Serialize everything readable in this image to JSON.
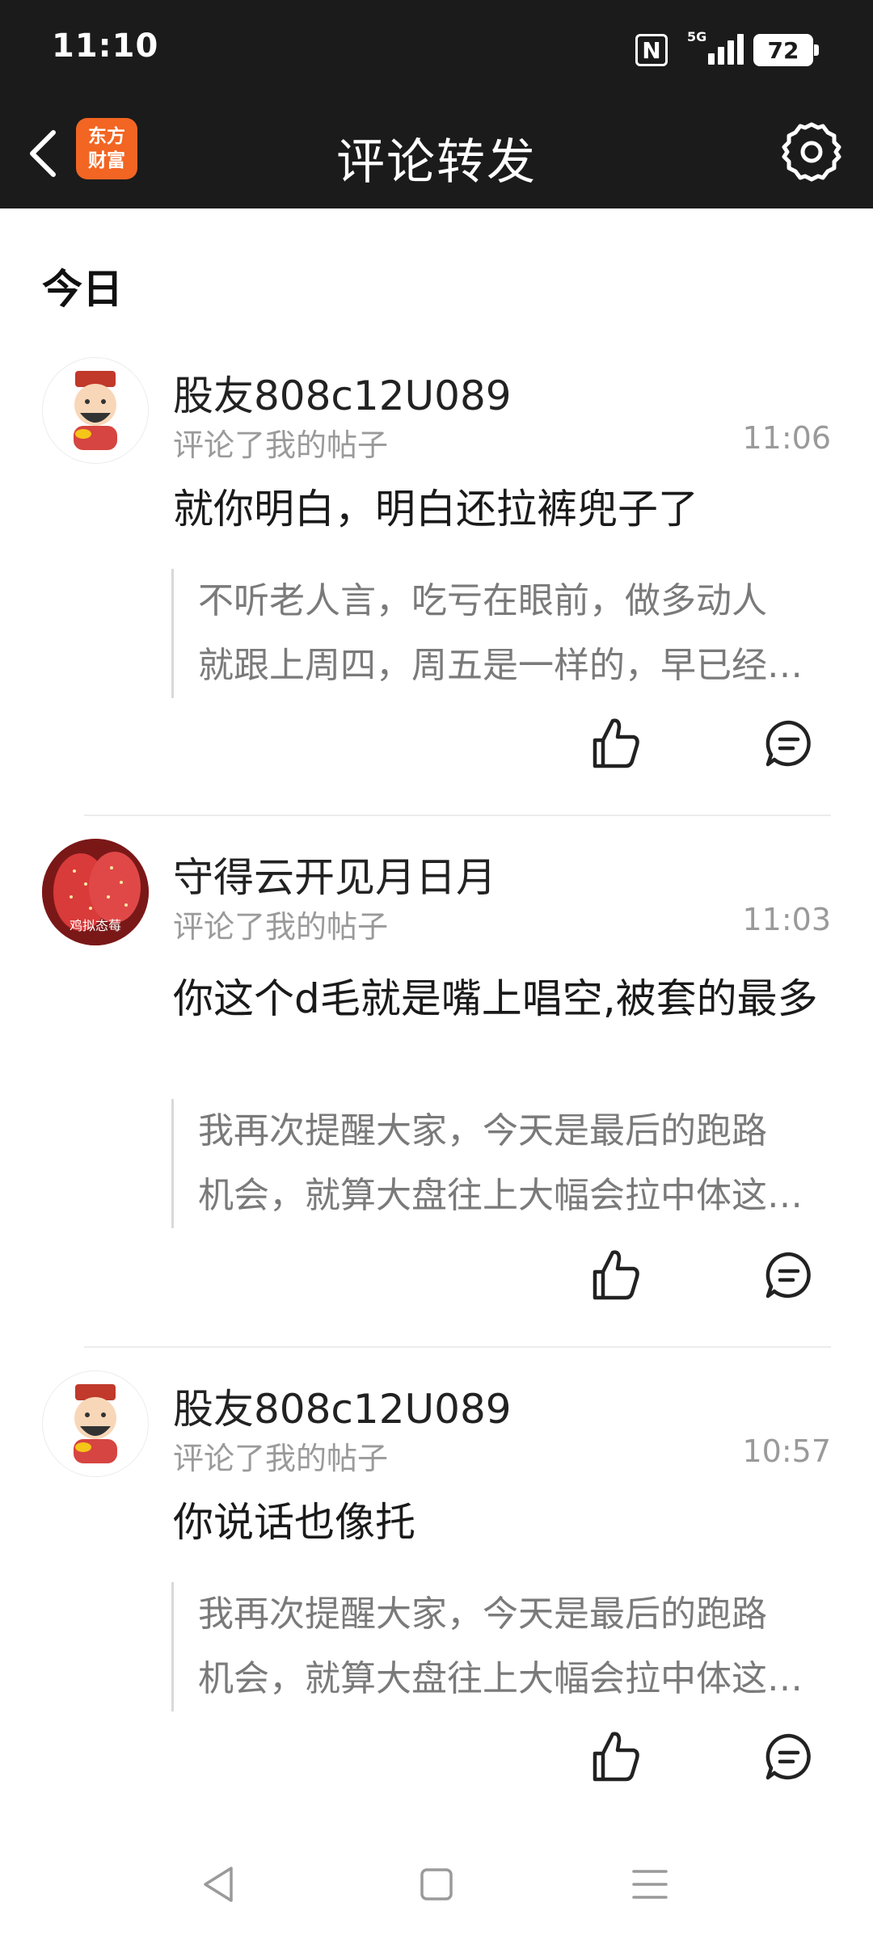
{
  "status_bar": {
    "time": "11:10",
    "network": "5G",
    "battery": "72"
  },
  "nav": {
    "title": "评论转发",
    "logo_line1": "东方",
    "logo_line2": "财富"
  },
  "section": {
    "title": "今日"
  },
  "notifications": [
    {
      "username": "股友808c12U089",
      "action": "评论了我的帖子",
      "time": "11:06",
      "comment": "就你明白，明白还拉裤兜子了",
      "quote_line1": "不听老人言，吃亏在眼前，做多动人",
      "quote_line2": "就跟上周四，周五是一样的，早已经…"
    },
    {
      "username": "守得云开见月日月",
      "action": "评论了我的帖子",
      "time": "11:03",
      "comment": "你这个d毛就是嘴上唱空,被套的最多",
      "quote_line1": "我再次提醒大家，今天是最后的跑路",
      "quote_line2": "机会，就算大盘往上大幅会拉中体这…",
      "avatar_caption": "鸡拟态莓"
    },
    {
      "username": "股友808c12U089",
      "action": "评论了我的帖子",
      "time": "10:57",
      "comment": "你说话也像托",
      "quote_line1": "我再次提醒大家，今天是最后的跑路",
      "quote_line2": "机会，就算大盘往上大幅会拉中体这…"
    }
  ],
  "colors": {
    "header_bg": "#1b1b1b",
    "brand_orange": "#f26522",
    "muted_text": "#9a9a9a"
  }
}
